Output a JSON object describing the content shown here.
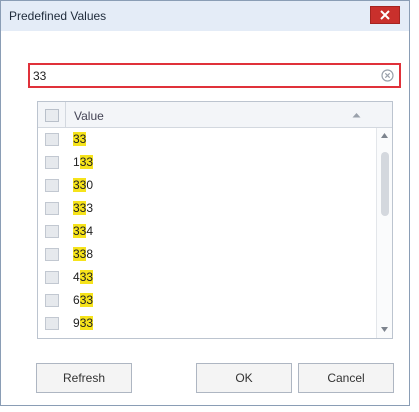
{
  "dialog": {
    "title": "Predefined Values"
  },
  "search": {
    "value": "33",
    "placeholder": ""
  },
  "grid": {
    "column_header": "Value",
    "rows": [
      {
        "parts": [
          {
            "t": "33",
            "hl": true
          }
        ]
      },
      {
        "parts": [
          {
            "t": "1",
            "hl": false
          },
          {
            "t": "33",
            "hl": true
          }
        ]
      },
      {
        "parts": [
          {
            "t": "33",
            "hl": true
          },
          {
            "t": "0",
            "hl": false
          }
        ]
      },
      {
        "parts": [
          {
            "t": "33",
            "hl": true
          },
          {
            "t": "3",
            "hl": false
          }
        ]
      },
      {
        "parts": [
          {
            "t": "33",
            "hl": true
          },
          {
            "t": "4",
            "hl": false
          }
        ]
      },
      {
        "parts": [
          {
            "t": "33",
            "hl": true
          },
          {
            "t": "8",
            "hl": false
          }
        ]
      },
      {
        "parts": [
          {
            "t": "4",
            "hl": false
          },
          {
            "t": "33",
            "hl": true
          }
        ]
      },
      {
        "parts": [
          {
            "t": "6",
            "hl": false
          },
          {
            "t": "33",
            "hl": true
          }
        ]
      },
      {
        "parts": [
          {
            "t": "9",
            "hl": false
          },
          {
            "t": "33",
            "hl": true
          }
        ]
      }
    ]
  },
  "buttons": {
    "refresh": "Refresh",
    "ok": "OK",
    "cancel": "Cancel"
  },
  "icons": {
    "close": "close-icon",
    "clear": "clear-search-icon",
    "sort": "sort-ascending-icon",
    "scroll_up": "scroll-up-icon",
    "scroll_down": "scroll-down-icon"
  },
  "colors": {
    "close_bg": "#c9302c",
    "search_border": "#e0313a",
    "highlight": "#f6e31b"
  }
}
